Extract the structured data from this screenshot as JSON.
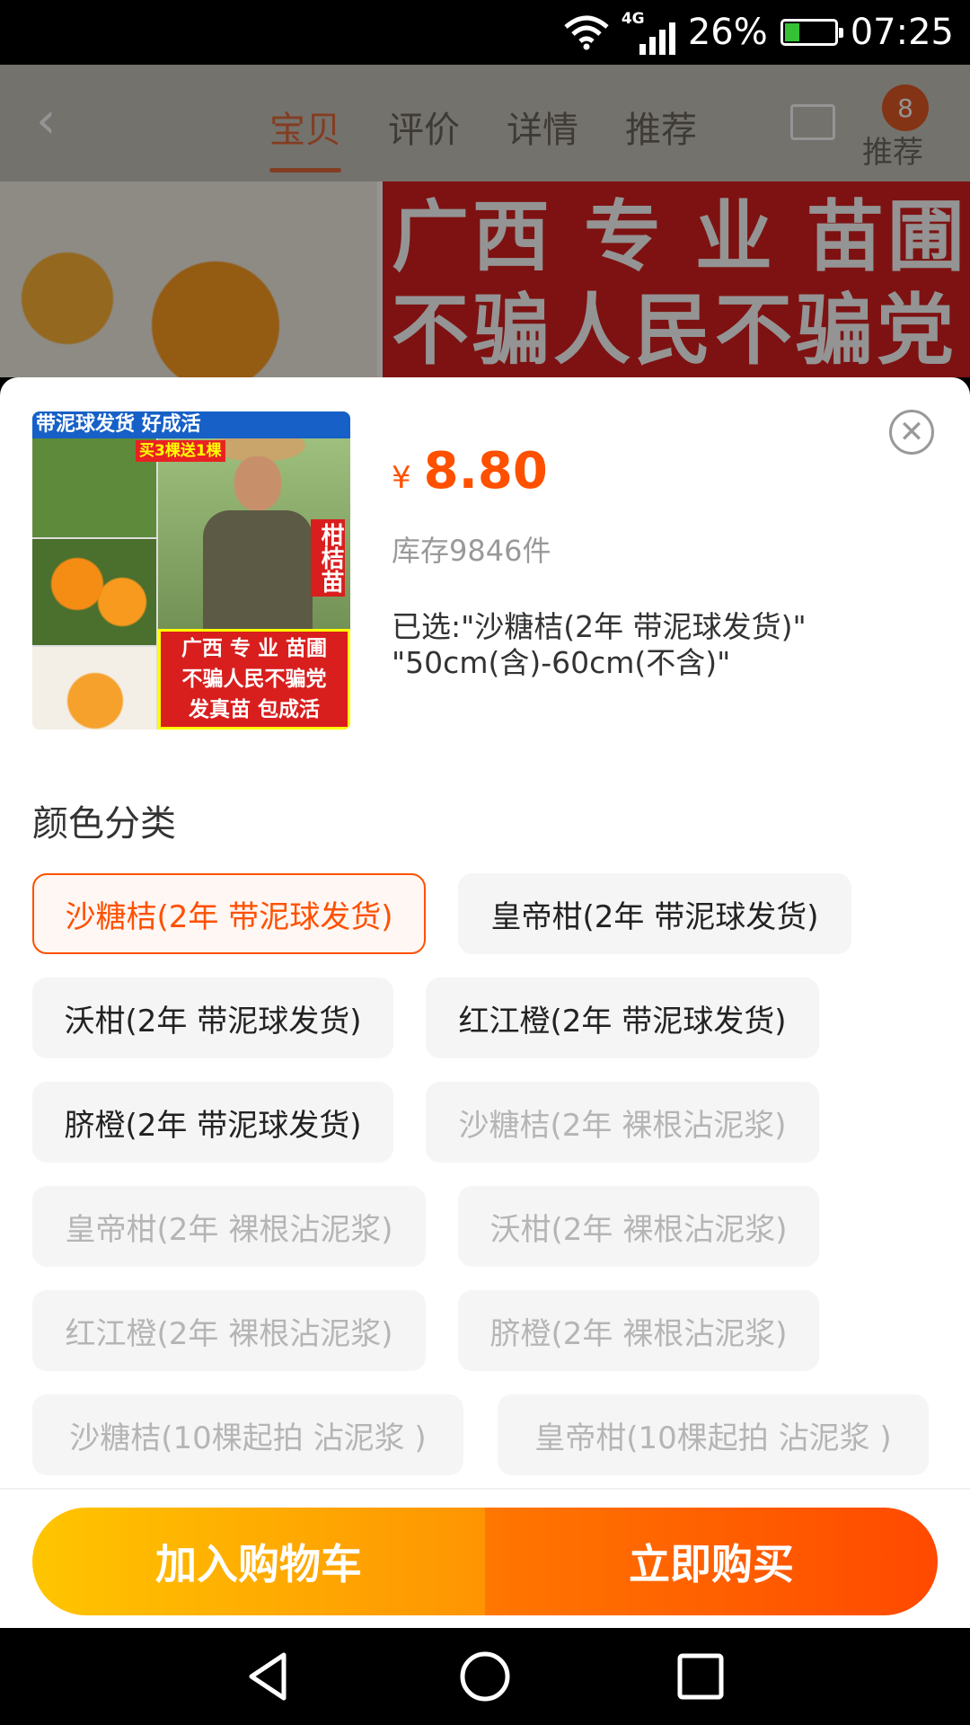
{
  "status_bar": {
    "network": "4G",
    "battery": "26%",
    "time": "07:25"
  },
  "background": {
    "tabs": [
      "宝贝",
      "评价",
      "详情",
      "推荐"
    ],
    "cart_badge": "8",
    "recommend_label": "推荐",
    "banner_line1": "广西 专 业 苗圃",
    "banner_line2": "不骗人民不骗党"
  },
  "product": {
    "thumb_top": "带泥球发货 好成活",
    "thumb_sub": "买3棵送1棵",
    "thumb_vertical": "柑桔苗",
    "thumb_banner": [
      "广西 专 业 苗圃",
      "不骗人民不骗党",
      "发真苗 包成活"
    ],
    "currency": "¥",
    "price": "8.80",
    "stock": "库存9846件",
    "selected_line1": "已选:\"沙糖桔(2年 带泥球发货)\"",
    "selected_line2": "\"50cm(含)-60cm(不含)\""
  },
  "options": {
    "section_title": "颜色分类",
    "chips": [
      {
        "label": "沙糖桔(2年 带泥球发货)",
        "state": "selected"
      },
      {
        "label": "皇帝柑(2年 带泥球发货)",
        "state": "normal"
      },
      {
        "label": "沃柑(2年 带泥球发货)",
        "state": "normal"
      },
      {
        "label": "红江橙(2年 带泥球发货)",
        "state": "normal"
      },
      {
        "label": "脐橙(2年 带泥球发货)",
        "state": "normal"
      },
      {
        "label": "沙糖桔(2年 裸根沾泥浆)",
        "state": "disabled"
      },
      {
        "label": "皇帝柑(2年 裸根沾泥浆)",
        "state": "disabled"
      },
      {
        "label": "沃柑(2年 裸根沾泥浆)",
        "state": "disabled"
      },
      {
        "label": "红江橙(2年 裸根沾泥浆)",
        "state": "disabled"
      },
      {
        "label": "脐橙(2年 裸根沾泥浆)",
        "state": "disabled"
      },
      {
        "label": "沙糖桔(10棵起拍 沾泥浆 )",
        "state": "disabled"
      },
      {
        "label": "皇帝柑(10棵起拍 沾泥浆 )",
        "state": "disabled"
      }
    ]
  },
  "actions": {
    "add_to_cart": "加入购物车",
    "buy_now": "立即购买"
  },
  "colors": {
    "accent": "#ff5000",
    "cart_gradient": [
      "#ffc500",
      "#ff9402"
    ],
    "buy_gradient": [
      "#ff7700",
      "#ff4900"
    ]
  }
}
